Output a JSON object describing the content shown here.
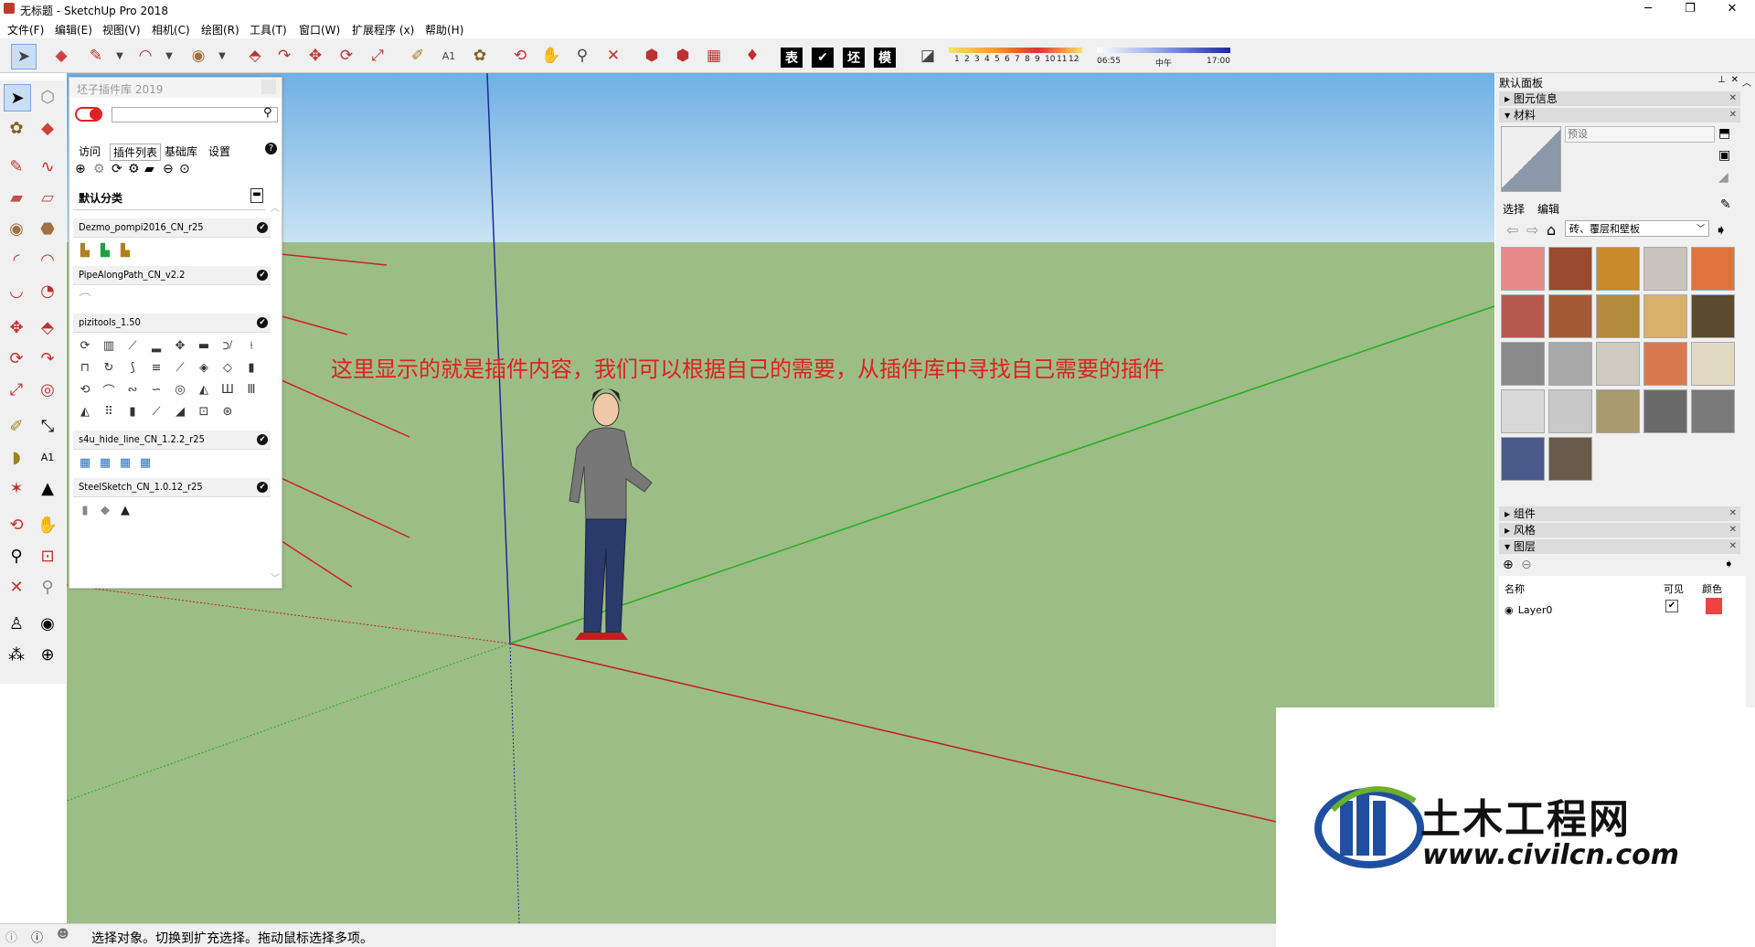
{
  "window": {
    "title": "无标题 - SketchUp Pro 2018",
    "minimize": "─",
    "maximize": "❐",
    "close": "✕"
  },
  "menu": [
    "文件(F)",
    "编辑(E)",
    "视图(V)",
    "相机(C)",
    "绘图(R)",
    "工具(T)",
    "窗口(W)",
    "扩展程序 (x)",
    "帮助(H)"
  ],
  "toolbar": {
    "shadow_labels": [
      "表",
      "✔",
      "坯",
      "模"
    ],
    "date_ticks": [
      "1",
      "2",
      "3",
      "4",
      "5",
      "6",
      "7",
      "8",
      "9",
      "10",
      "11",
      "12"
    ],
    "time_start": "06:55",
    "time_mid": "中午",
    "time_end": "17:00"
  },
  "plugin_panel": {
    "title": "坯子插件库 2019",
    "search_placeholder": "",
    "tabs": [
      "访问",
      "插件列表",
      "基础库",
      "设置"
    ],
    "active_tab": "插件列表",
    "help": "?",
    "category": "默认分类",
    "plugins": [
      {
        "name": "Dezmo_pompi2016_CN_r25"
      },
      {
        "name": "PipeAlongPath_CN_v2.2"
      },
      {
        "name": "pizitools_1.50"
      },
      {
        "name": "s4u_hide_line_CN_1.2.2_r25"
      },
      {
        "name": "SteelSketch_CN_1.0.12_r25"
      }
    ]
  },
  "annotation": "这里显示的就是插件内容，我们可以根据自己的需要，从插件库中寻找自己需要的插件",
  "right_panel": {
    "header": "默认面板",
    "entity_info": "图元信息",
    "materials": "材料",
    "material_name_placeholder": "预设",
    "tab_select": "选择",
    "tab_edit": "编辑",
    "library_dropdown": "砖、覆层和壁板",
    "components": "组件",
    "styles": "风格",
    "layers": "图层",
    "layers_col_name": "名称",
    "layers_col_visible": "可见",
    "layers_col_color": "颜色",
    "layer0": "Layer0",
    "swatch_colors": [
      "#e88a8a",
      "#9a4a2e",
      "#c98a2a",
      "#c9c4bd",
      "#e0743e",
      "#b5584e",
      "#a35a34",
      "#b38a3a",
      "#d8b06a",
      "#5a4a2e",
      "#8a8a8a",
      "#a8a8a8",
      "#cfcac0",
      "#d97a4e",
      "#e2d9c2",
      "#d8d8d8",
      "#c8c8c8",
      "#a89a6a",
      "#6a6a6a",
      "#7a7a7a",
      "#4a5a8a",
      "#6a5a4a"
    ],
    "layer_color": "#ee4444"
  },
  "status": {
    "text": "选择对象。切换到扩充选择。拖动鼠标选择多项。"
  },
  "watermark": {
    "brand": "土木工程网",
    "url": "www.civilcn.com"
  }
}
